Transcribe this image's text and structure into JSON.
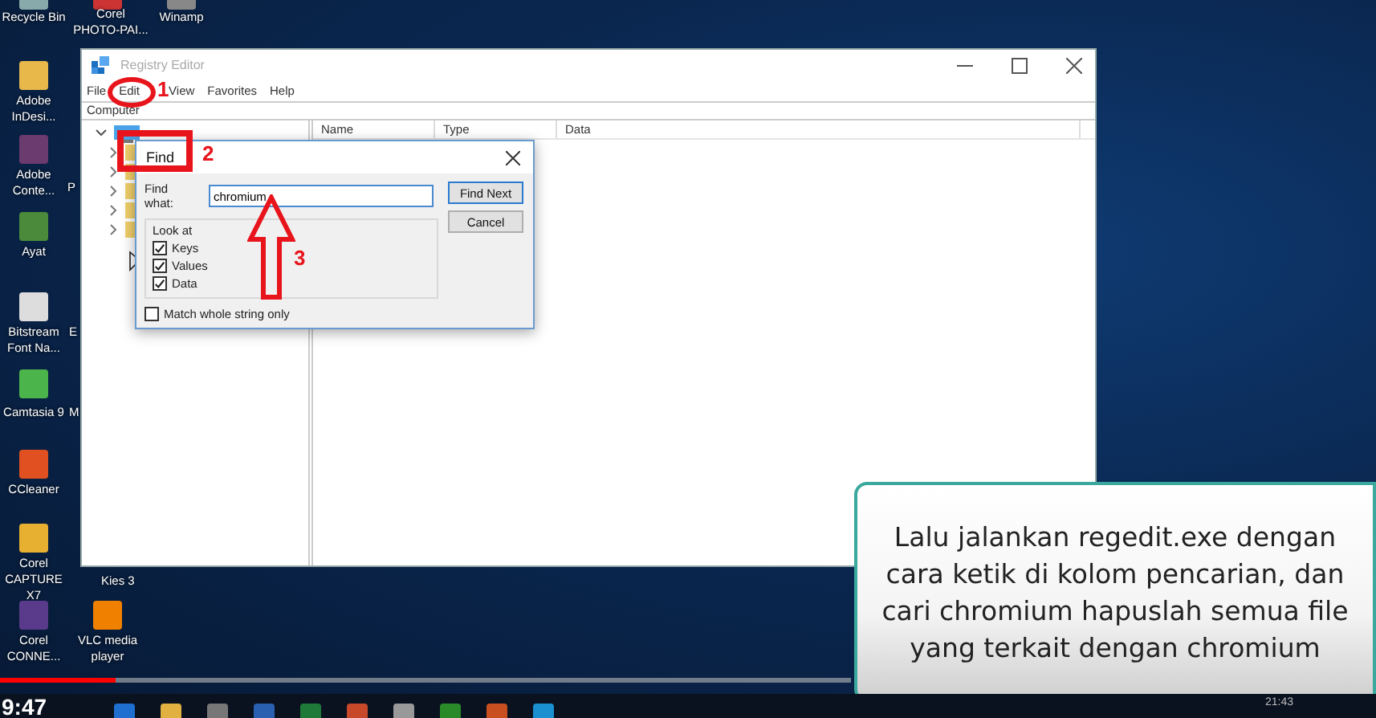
{
  "desktop_icons": [
    {
      "label": "Recycle Bin"
    },
    {
      "label": "Corel PHOTO-PAI..."
    },
    {
      "label": "Winamp"
    },
    {
      "label": "Adobe InDesi..."
    },
    {
      "label": "Adobe Conte..."
    },
    {
      "label": "P"
    },
    {
      "label": "Ayat"
    },
    {
      "label": "Bitstream Font Na..."
    },
    {
      "label": "E"
    },
    {
      "label": "Camtasia 9"
    },
    {
      "label": "M"
    },
    {
      "label": "CCleaner"
    },
    {
      "label": "Corel CAPTURE X7"
    },
    {
      "label": "Kies 3"
    },
    {
      "label": "Corel CONNE..."
    },
    {
      "label": "VLC media player"
    }
  ],
  "registry_editor": {
    "title": "Registry Editor",
    "menu": [
      "File",
      "Edit",
      "View",
      "Favorites",
      "Help"
    ],
    "address": "Computer",
    "columns": [
      "Name",
      "Type",
      "Data"
    ]
  },
  "find_dialog": {
    "title": "Find",
    "find_what_label": "Find what:",
    "value": "chromium",
    "look_at_label": "Look at",
    "options": [
      {
        "label": "Keys",
        "checked": true
      },
      {
        "label": "Values",
        "checked": true
      },
      {
        "label": "Data",
        "checked": true
      }
    ],
    "match_whole": {
      "label": "Match whole string only",
      "checked": false
    },
    "buttons": [
      "Find Next",
      "Cancel"
    ]
  },
  "annotations": [
    "1",
    "2",
    "3"
  ],
  "caption": "Lalu jalankan regedit.exe dengan cara ketik di kolom pencarian, dan cari chromium hapuslah semua file yang terkait dengan chromium",
  "video": {
    "level": 0.084,
    "time": "9:47"
  },
  "taskbar": {
    "clock": "21:43"
  }
}
